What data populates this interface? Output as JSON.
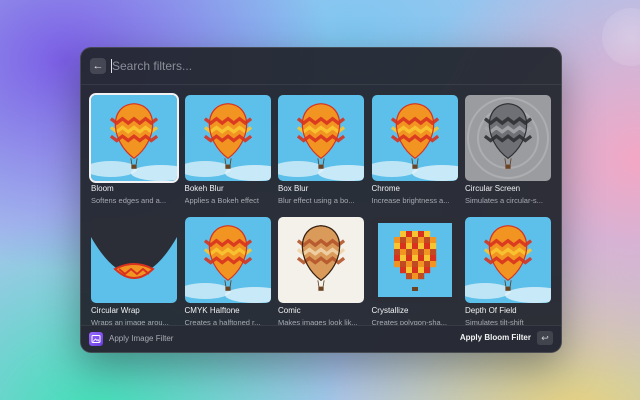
{
  "search": {
    "placeholder": "Search filters..."
  },
  "filters": [
    {
      "name": "Bloom",
      "desc": "Softens edges and a...",
      "style": "normal",
      "selected": true
    },
    {
      "name": "Bokeh Blur",
      "desc": "Applies a Bokeh effect",
      "style": "normal"
    },
    {
      "name": "Box Blur",
      "desc": "Blur effect using a bo...",
      "style": "normal"
    },
    {
      "name": "Chrome",
      "desc": "Increase brightness a...",
      "style": "normal"
    },
    {
      "name": "Circular Screen",
      "desc": "Simulates a circular-s...",
      "style": "gray"
    },
    {
      "name": "Circular Wrap",
      "desc": "Wraps an image arou...",
      "style": "wrap"
    },
    {
      "name": "CMYK Halftone",
      "desc": "Creates a halftoned r...",
      "style": "normal"
    },
    {
      "name": "Comic",
      "desc": "Makes images look lik...",
      "style": "comic"
    },
    {
      "name": "Crystallize",
      "desc": "Creates polygon-sha...",
      "style": "crystal"
    },
    {
      "name": "Depth Of Field",
      "desc": "Simulates tilt-shift",
      "style": "normal"
    }
  ],
  "footer": {
    "label": "Apply Image Filter",
    "action": "Apply Bloom Filter",
    "shortcut": "↩"
  },
  "colors": {
    "sky": "#5cc0ea",
    "balloon_red": "#d8321f",
    "balloon_orange": "#f29422",
    "balloon_yellow": "#f7c531"
  }
}
